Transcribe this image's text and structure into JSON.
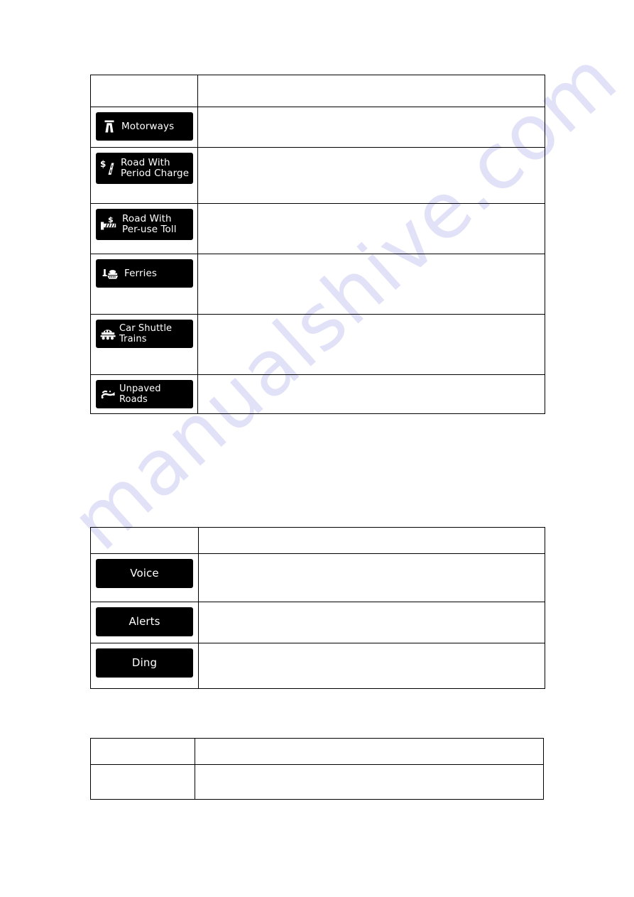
{
  "document": {
    "watermark": "manualshive.com"
  },
  "tables": {
    "route_preferences": {
      "name": "route-restriction-settings",
      "columns": [
        "",
        ""
      ],
      "rows": [
        {
          "kind": "header",
          "button": null,
          "description": ""
        },
        {
          "kind": "item",
          "button": {
            "label": "Motorways",
            "icon": "motorway-icon",
            "layout": "one-line"
          },
          "description": ""
        },
        {
          "kind": "item",
          "button": {
            "label": "Road With\nPeriod Charge",
            "icon": "period-charge-icon",
            "layout": "two-line"
          },
          "description": ""
        },
        {
          "kind": "item",
          "button": {
            "label": "Road With\nPer-use Toll",
            "icon": "per-use-toll-icon",
            "layout": "two-line"
          },
          "description": ""
        },
        {
          "kind": "item",
          "button": {
            "label": "Ferries",
            "icon": "ferry-icon",
            "layout": "one-line"
          },
          "description": ""
        },
        {
          "kind": "item",
          "button": {
            "label": "Car Shuttle Trains",
            "icon": "car-shuttle-train-icon",
            "layout": "one-line"
          },
          "description": ""
        },
        {
          "kind": "item",
          "button": {
            "label": "Unpaved Roads",
            "icon": "unpaved-road-icon",
            "layout": "one-line"
          },
          "description": ""
        }
      ]
    },
    "sound_preferences": {
      "name": "sound-settings",
      "columns": [
        "",
        ""
      ],
      "rows": [
        {
          "kind": "header",
          "button": null,
          "description": ""
        },
        {
          "kind": "item",
          "button": {
            "label": "Voice",
            "icon": null,
            "layout": "centered"
          },
          "description": ""
        },
        {
          "kind": "item",
          "button": {
            "label": "Alerts",
            "icon": null,
            "layout": "centered"
          },
          "description": ""
        },
        {
          "kind": "item",
          "button": {
            "label": "Ding",
            "icon": null,
            "layout": "centered"
          },
          "description": ""
        }
      ]
    },
    "extra": {
      "name": "empty-settings-table",
      "columns": [
        "",
        ""
      ],
      "rows": [
        {
          "kind": "header",
          "button": null,
          "description": ""
        },
        {
          "kind": "item",
          "button": null,
          "description": ""
        }
      ]
    }
  },
  "labels": {
    "motorways": "Motorways",
    "road_with_period_charge": "Road With\nPeriod Charge",
    "road_with_per_use_toll": "Road With\nPer-use Toll",
    "ferries": "Ferries",
    "car_shuttle_trains": "Car Shuttle Trains",
    "unpaved_roads": "Unpaved Roads",
    "voice": "Voice",
    "alerts": "Alerts",
    "ding": "Ding"
  },
  "colors": {
    "button_background": "#000000",
    "button_text": "#ffffff",
    "table_border": "#000000",
    "page_background": "#ffffff",
    "watermark": "#c9cbf2"
  }
}
